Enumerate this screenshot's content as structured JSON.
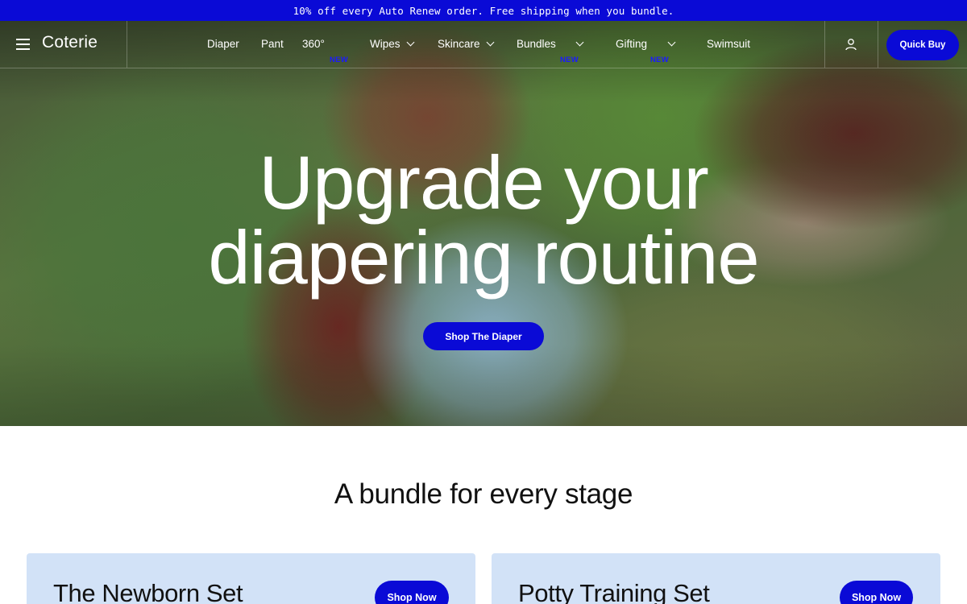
{
  "announcement": "10% off every Auto Renew order. Free shipping when you bundle.",
  "header": {
    "logo": "Coterie",
    "nav": [
      {
        "label": "Diaper"
      },
      {
        "label": "Pant"
      },
      {
        "label": "360°",
        "badge": "NEW"
      },
      {
        "label": "Wipes",
        "dropdown": true
      },
      {
        "label": "Skincare",
        "dropdown": true
      },
      {
        "label": "Bundles",
        "badge": "NEW",
        "dropdown": true
      },
      {
        "label": "Gifting",
        "badge": "NEW",
        "dropdown": true
      },
      {
        "label": "Swimsuit"
      }
    ],
    "quick_buy": "Quick Buy"
  },
  "hero": {
    "title_line1": "Upgrade your",
    "title_line2": "diapering routine",
    "cta": "Shop The Diaper"
  },
  "bundles": {
    "title": "A bundle for every stage",
    "cards": [
      {
        "title": "The Newborn Set",
        "cta": "Shop Now"
      },
      {
        "title": "Potty Training Set",
        "cta": "Shop Now"
      }
    ]
  },
  "colors": {
    "brand_blue": "#0a0ad6",
    "card_bg": "#d2e2f7",
    "badge_blue": "#1a1aff"
  },
  "icons": [
    "menu-icon",
    "chevron-down-icon",
    "account-icon"
  ]
}
